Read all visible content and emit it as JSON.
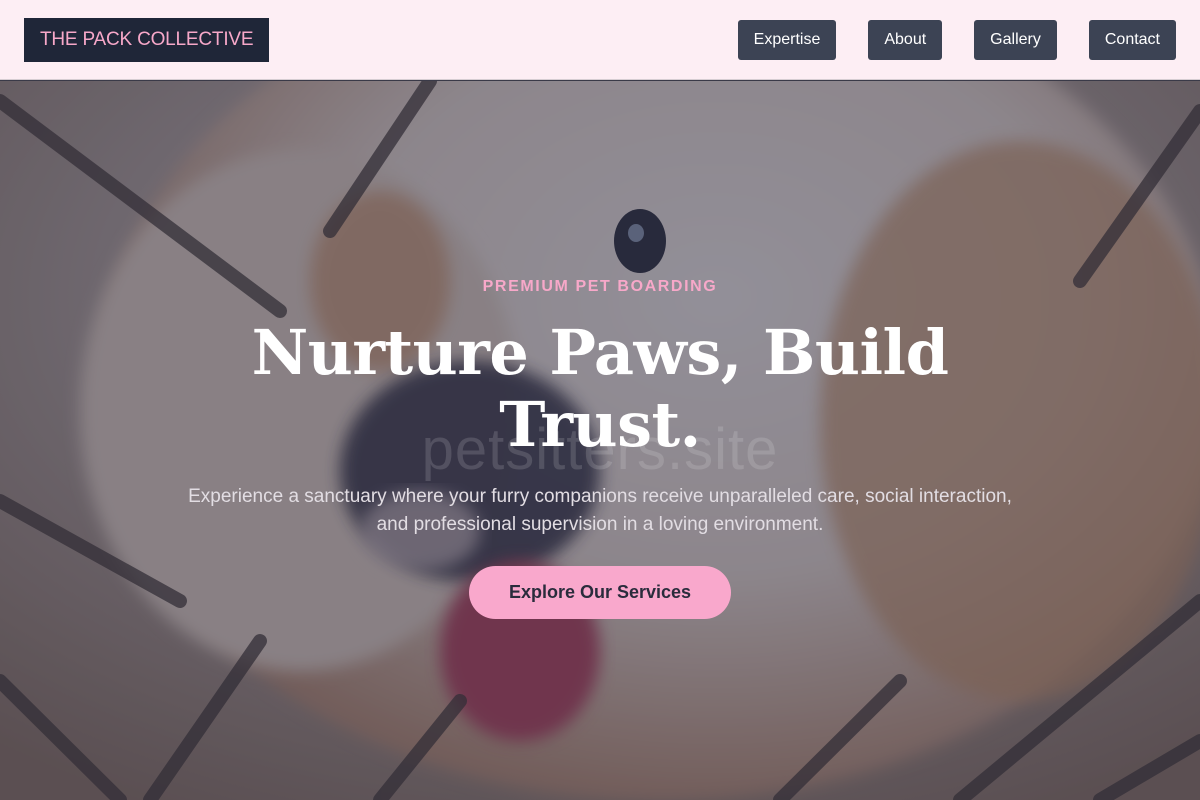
{
  "header": {
    "logo": "THE PACK COLLECTIVE",
    "nav": [
      {
        "label": "Expertise"
      },
      {
        "label": "About"
      },
      {
        "label": "Gallery"
      },
      {
        "label": "Contact"
      }
    ]
  },
  "hero": {
    "eyebrow": "PREMIUM PET BOARDING",
    "headline": "Nurture Paws, Build Trust.",
    "watermark": "petsitters.site",
    "lede": "Experience a sanctuary where your furry companions receive unparalleled care, social interaction, and professional supervision in a loving environment.",
    "cta_label": "Explore Our Services"
  },
  "colors": {
    "header_bg": "#fdeef4",
    "logo_bg": "#1f2638",
    "accent_pink": "#f9a8cc",
    "nav_button_bg": "#3c4354"
  }
}
